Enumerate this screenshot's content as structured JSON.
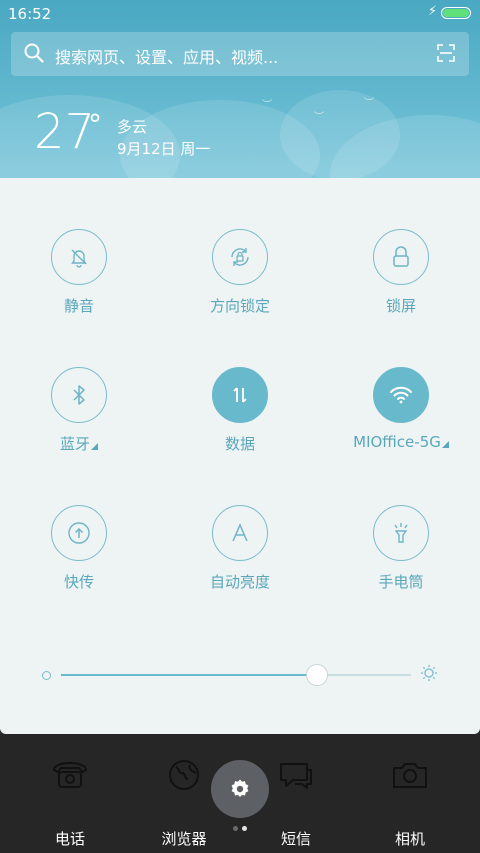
{
  "status": {
    "time": "16:52"
  },
  "search": {
    "placeholder": "搜索网页、设置、应用、视频..."
  },
  "weather": {
    "temperature": "27",
    "degree": "°",
    "condition": "多云",
    "date": "9月12日 周一"
  },
  "toggles": [
    {
      "label": "静音",
      "icon": "bell-mute-icon",
      "on": false
    },
    {
      "label": "方向锁定",
      "icon": "rotation-lock-icon",
      "on": false
    },
    {
      "label": "锁屏",
      "icon": "lock-icon",
      "on": false
    },
    {
      "label": "蓝牙",
      "icon": "bluetooth-icon",
      "on": false
    },
    {
      "label": "数据",
      "icon": "mobile-data-icon",
      "on": true
    },
    {
      "label": "MIOffice-5G",
      "icon": "wifi-icon",
      "on": true
    },
    {
      "label": "快传",
      "icon": "quick-transfer-icon",
      "on": false
    },
    {
      "label": "自动亮度",
      "icon": "auto-brightness-icon",
      "on": false
    },
    {
      "label": "手电筒",
      "icon": "flashlight-icon",
      "on": false
    }
  ],
  "brightness": {
    "level": 0.73
  },
  "dock": {
    "apps": [
      "电话",
      "浏览器",
      "短信",
      "相机"
    ]
  },
  "colors": {
    "accent": "#68b9cb",
    "header": "#5cb3ca",
    "panel": "#eef3f4"
  }
}
